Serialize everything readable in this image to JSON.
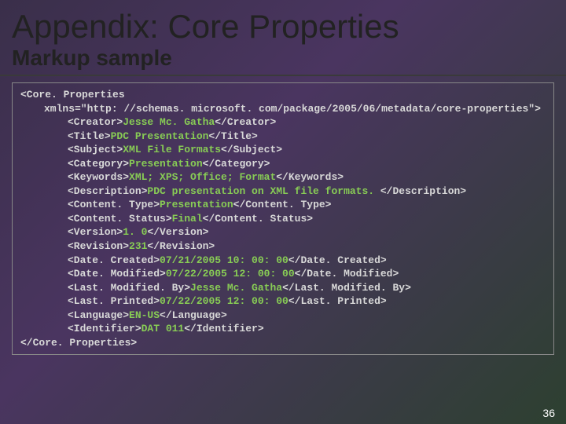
{
  "title": "Appendix: Core Properties",
  "subtitle": "Markup sample",
  "pageNumber": "36",
  "code": {
    "openRoot": "<Core. Properties",
    "xmlns": "xmlns=\"http: //schemas. microsoft. com/package/2005/06/metadata/core-properties\">",
    "lines": [
      {
        "open": "<Creator>",
        "val": "Jesse Mc. Gatha",
        "close": "</Creator>"
      },
      {
        "open": "<Title>",
        "val": "PDC Presentation",
        "close": "</Title>"
      },
      {
        "open": "<Subject>",
        "val": "XML File Formats",
        "close": "</Subject>"
      },
      {
        "open": "<Category>",
        "val": "Presentation",
        "close": "</Category>"
      },
      {
        "open": "<Keywords>",
        "val": "XML; XPS; Office; Format",
        "close": "</Keywords>"
      },
      {
        "open": "<Description>",
        "val": "PDC presentation on XML file formats. ",
        "close": "</Description>"
      },
      {
        "open": "<Content. Type>",
        "val": "Presentation",
        "close": "</Content. Type>"
      },
      {
        "open": "<Content. Status>",
        "val": "Final",
        "close": "</Content. Status>"
      },
      {
        "open": "<Version>",
        "val": "1. 0",
        "close": "</Version>"
      },
      {
        "open": "<Revision>",
        "val": "231",
        "close": "</Revision>"
      },
      {
        "open": "<Date. Created>",
        "val": "07/21/2005 10: 00: 00",
        "close": "</Date. Created>"
      },
      {
        "open": "<Date. Modified>",
        "val": "07/22/2005 12: 00: 00",
        "close": "</Date. Modified>"
      },
      {
        "open": "<Last. Modified. By>",
        "val": "Jesse Mc. Gatha",
        "close": "</Last. Modified. By>"
      },
      {
        "open": "<Last. Printed>",
        "val": "07/22/2005 12: 00: 00",
        "close": "</Last. Printed>"
      },
      {
        "open": "<Language>",
        "val": "EN-US",
        "close": "</Language>"
      },
      {
        "open": "<Identifier>",
        "val": "DAT 011",
        "close": "</Identifier>"
      }
    ],
    "closeRoot": "</Core. Properties>"
  }
}
